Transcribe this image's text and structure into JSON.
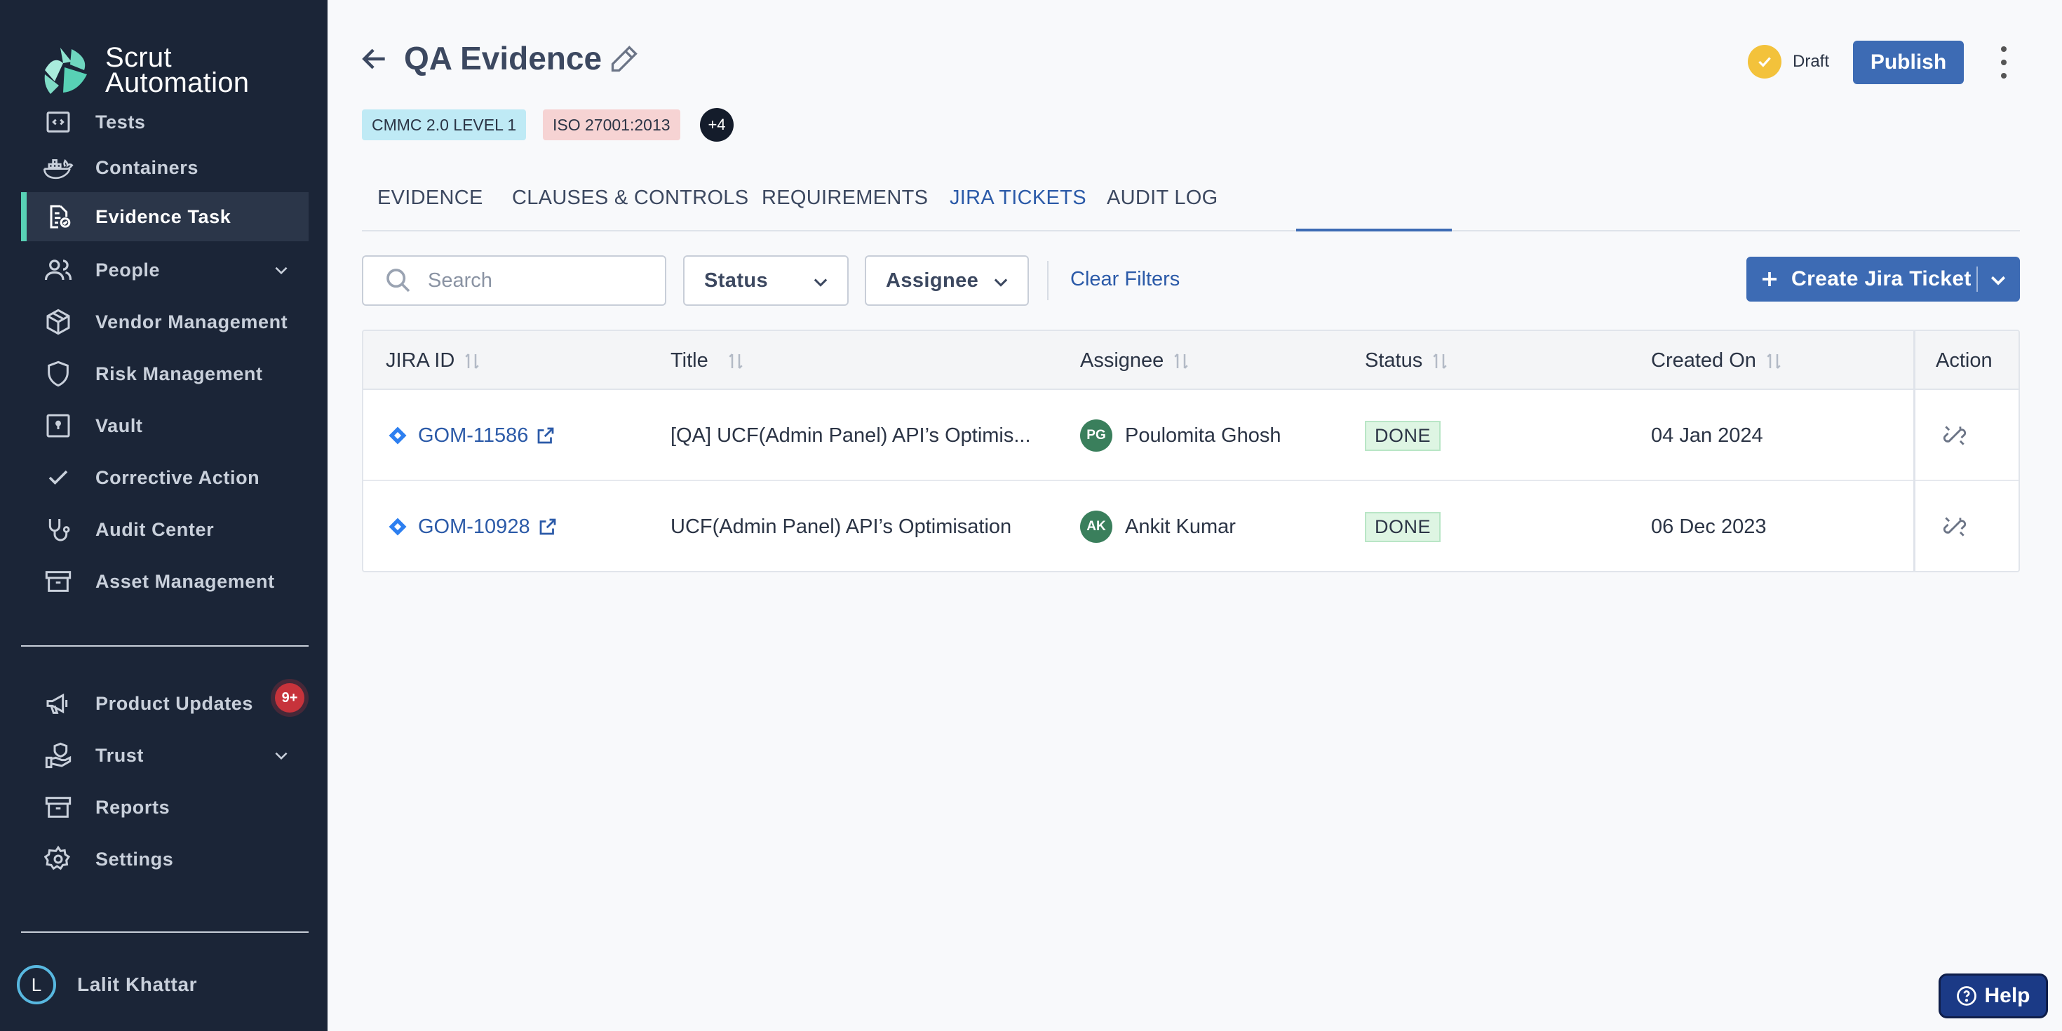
{
  "brand": {
    "line1": "Scrut",
    "line2": "Automation"
  },
  "sidebar": {
    "items": [
      {
        "label": "Tests",
        "icon": "code-window-icon"
      },
      {
        "label": "Containers",
        "icon": "docker-icon"
      },
      {
        "label": "Evidence Task",
        "icon": "evidence-doc-icon",
        "active": true
      },
      {
        "label": "People",
        "icon": "people-icon"
      },
      {
        "label": "Vendor Management",
        "icon": "box-icon"
      },
      {
        "label": "Risk Management",
        "icon": "shield-icon"
      },
      {
        "label": "Vault",
        "icon": "vault-icon"
      },
      {
        "label": "Corrective Action",
        "icon": "check-icon"
      },
      {
        "label": "Audit Center",
        "icon": "stethoscope-icon"
      },
      {
        "label": "Asset Management",
        "icon": "archive-icon"
      }
    ],
    "bottom_items": [
      {
        "label": "Product Updates",
        "icon": "megaphone-icon"
      },
      {
        "label": "Trust",
        "icon": "hand-shield-icon"
      },
      {
        "label": "Reports",
        "icon": "archive-icon"
      },
      {
        "label": "Settings",
        "icon": "gear-icon"
      }
    ],
    "updates_badge": "9+",
    "user": {
      "initial": "L",
      "name": "Lalit Khattar"
    }
  },
  "header": {
    "title": "QA Evidence",
    "status_label": "Draft",
    "publish_label": "Publish",
    "tags": [
      "CMMC 2.0 LEVEL 1",
      "ISO 27001:2013"
    ],
    "more_tags": "+4"
  },
  "tabs": [
    "EVIDENCE",
    "CLAUSES & CONTROLS",
    "REQUIREMENTS",
    "JIRA TICKETS",
    "AUDIT LOG"
  ],
  "active_tab": "JIRA TICKETS",
  "filters": {
    "search_placeholder": "Search",
    "status_label": "Status",
    "assignee_label": "Assignee",
    "clear_label": "Clear Filters",
    "create_label": "Create Jira Ticket"
  },
  "table": {
    "headers": [
      "JIRA ID",
      "Title",
      "Assignee",
      "Status",
      "Created On",
      "Action"
    ],
    "rows": [
      {
        "jira_id": "GOM-11586",
        "title": "[QA] UCF(Admin Panel) API’s Optimis...",
        "assignee_initials": "PG",
        "assignee": "Poulomita Ghosh",
        "status": "DONE",
        "created_on": "04 Jan 2024"
      },
      {
        "jira_id": "GOM-10928",
        "title": "UCF(Admin Panel) API’s Optimisation",
        "assignee_initials": "AK",
        "assignee": "Ankit Kumar",
        "status": "DONE",
        "created_on": "06 Dec 2023"
      }
    ]
  },
  "help_label": "Help",
  "colors": {
    "sidebar_bg": "#1b2537",
    "accent": "#3d6bb4",
    "active_bar": "#58d1b5",
    "done_bg": "#def5e3"
  }
}
